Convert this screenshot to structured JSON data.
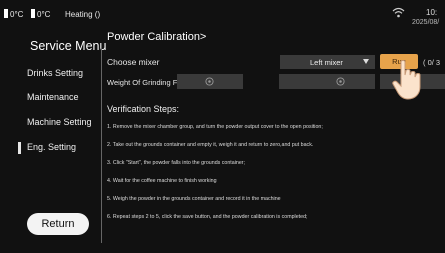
{
  "status": {
    "temp1": "0°C",
    "temp2": "0°C",
    "heating": "Heating ()",
    "time": "10:",
    "date": "2025/08/"
  },
  "sidebar": {
    "title": "Service Menu",
    "items": [
      {
        "label": "Drinks Setting"
      },
      {
        "label": "Maintenance"
      },
      {
        "label": "Machine Setting"
      },
      {
        "label": "Eng. Setting"
      }
    ],
    "return_label": "Return"
  },
  "main": {
    "title": "Powder Calibration>",
    "choose_mixer_label": "Choose mixer",
    "mixer_selected": "Left mixer",
    "run_label": "Run",
    "run_count": "( 0/ 3",
    "weight_label": "Weight Of Grinding F",
    "verification_title": "Verification Steps:",
    "steps": [
      "1. Remove the mixer chamber group, and turn the powder output cover to the open position;",
      "2. Take out the grounds container and empty it, weigh it and return to zero,and put back.",
      "3. Click \"Start\", the powder falls into the grounds container;",
      "4. Wait for the coffee machine to finish working",
      "5. Weigh the powder in the grounds container and record it in the machine",
      "6. Repeat steps 2 to 5, click the save button, and the powder calibration is completed;"
    ]
  },
  "colors": {
    "background": "#111111",
    "field": "#3a3a3a",
    "run_button": "#e7a34b",
    "return_button": "#f3f3f3"
  }
}
